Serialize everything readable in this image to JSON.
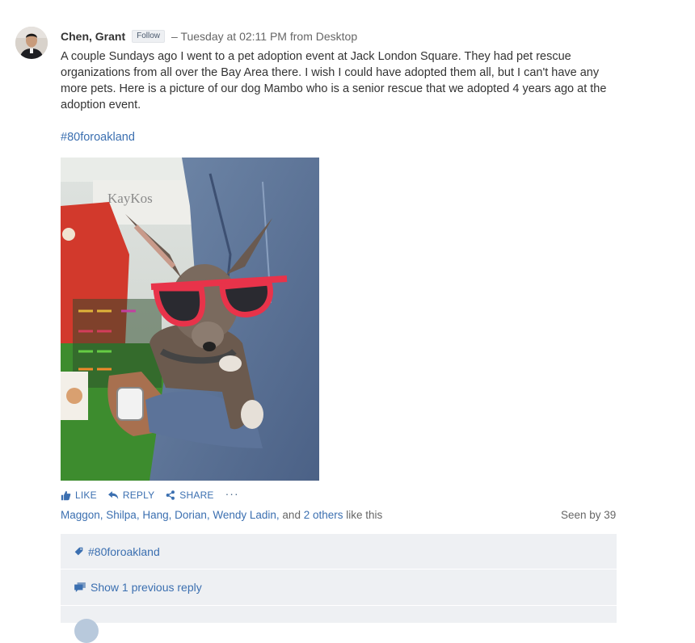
{
  "post": {
    "author": "Chen, Grant",
    "follow_label": "Follow",
    "meta": "– Tuesday at 02:11 PM from Desktop",
    "body": "A couple Sundays ago I went to a pet adoption event at Jack London Square.  They had pet rescue organizations from all over the Bay Area there.  I wish I could have adopted them all, but I can't have any more pets.  Here is a picture of our dog Mambo who is a senior rescue that we adopted 4 years ago at the adoption event.",
    "hashtag": "#80foroakland",
    "image_sign_text": "KayKos"
  },
  "actions": {
    "like": "LIKE",
    "reply": "REPLY",
    "share": "SHARE",
    "more": "···"
  },
  "likes": {
    "names": "Maggon, Shilpa, Hang, Dorian, Wendy Ladin,",
    "and_text": " and ",
    "others": "2 others",
    "suffix": " like this"
  },
  "seen_by": "Seen by 39",
  "topic_panel": {
    "label": "#80foroakland"
  },
  "replies_panel": {
    "label": "Show 1 previous reply"
  },
  "colors": {
    "link": "#3b6fb0",
    "panel_bg": "#eef0f3",
    "muted": "#666666"
  },
  "icons": {
    "like": "thumbs-up-icon",
    "reply": "reply-arrow-icon",
    "share": "share-icon",
    "topic": "tag-icon",
    "replies": "conversation-icon"
  }
}
